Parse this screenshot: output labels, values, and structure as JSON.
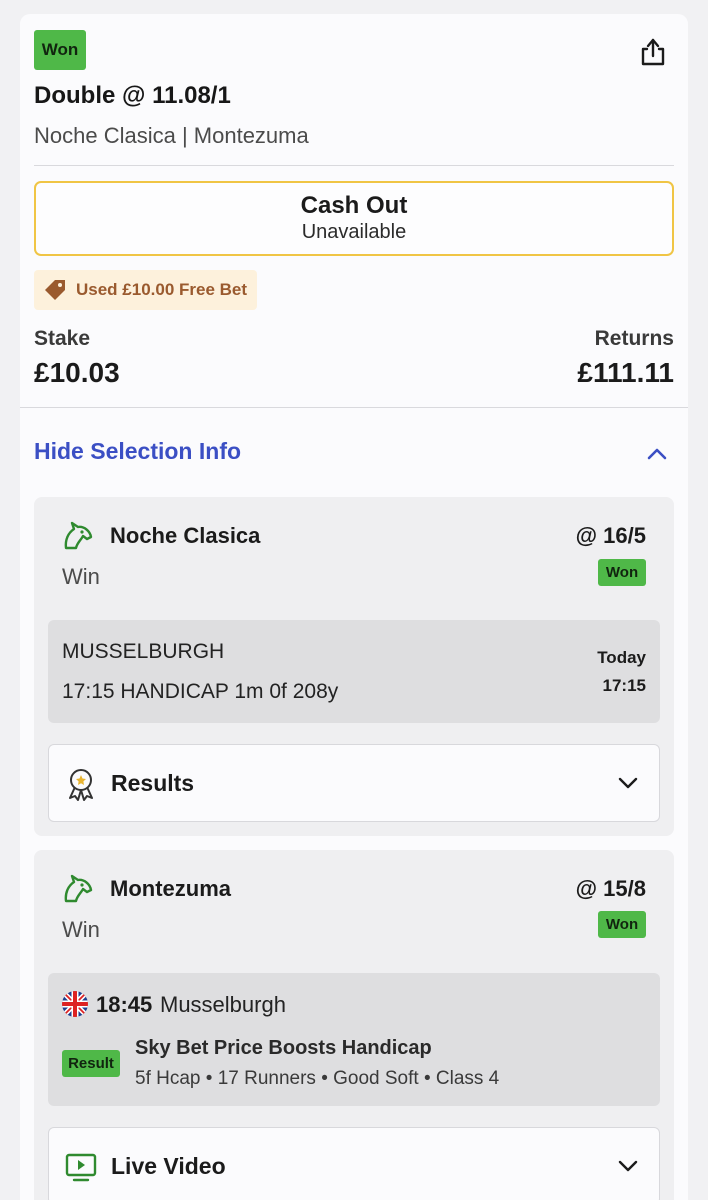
{
  "bet": {
    "status": "Won",
    "title": "Double @ 11.08/1",
    "selections_summary": "Noche Clasica | Montezuma",
    "share_icon": "share-icon"
  },
  "cashout": {
    "title": "Cash Out",
    "subtitle": "Unavailable"
  },
  "freebet": {
    "label": "Used £10.00 Free Bet",
    "icon": "tag-icon"
  },
  "stake": {
    "label": "Stake",
    "value": "£10.03"
  },
  "returns": {
    "label": "Returns",
    "value": "£111.11"
  },
  "selection_info": {
    "toggle_label": "Hide Selection Info",
    "toggle_icon": "chevron-up-icon",
    "accent": "#3b4fc4"
  },
  "selections": [
    {
      "name": "Noche Clasica",
      "market": "Win",
      "odds": "@ 16/5",
      "status": "Won",
      "venue": "MUSSELBURGH",
      "race": "17:15 HANDICAP 1m 0f 208y",
      "day": "Today",
      "time": "17:15",
      "expander_label": "Results",
      "expander_icon": "rosette-icon"
    },
    {
      "name": "Montezuma",
      "market": "Win",
      "odds": "@ 15/8",
      "status": "Won",
      "race_time": "18:45",
      "course": "Musselburgh",
      "result_badge": "Result",
      "race_title": "Sky Bet Price Boosts Handicap",
      "race_details": "5f Hcap • 17 Runners • Good Soft • Class 4",
      "expander_label": "Live Video",
      "expander_icon": "tv-icon"
    }
  ],
  "colors": {
    "won_green": "#4fb848",
    "cashout_border": "#f0c545",
    "freebet_bg": "#fdf1dc",
    "freebet_text": "#9a5a2e",
    "horse_icon": "#2f8a2f"
  }
}
